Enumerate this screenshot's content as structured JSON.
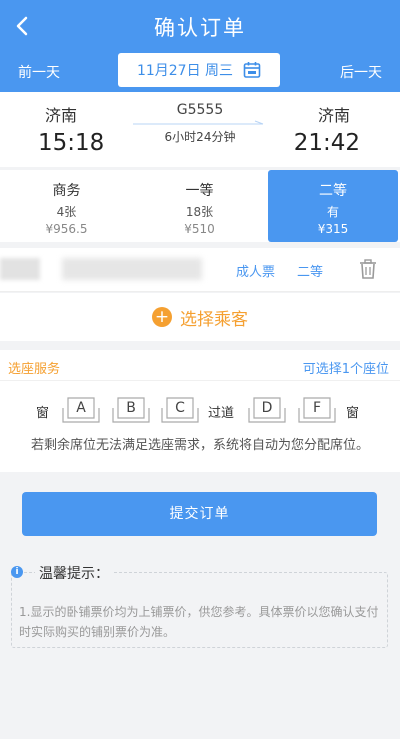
{
  "header": {
    "title": "确认订单",
    "prev_day": "前一天",
    "next_day": "后一天",
    "date": "11月27日 周三",
    "bg_color": "#4a97f0"
  },
  "train": {
    "from_station": "济南",
    "to_station": "济南",
    "departure_time": "15:18",
    "arrival_time": "21:42",
    "train_no": "G5555",
    "duration": "6小时24分钟"
  },
  "seat_classes": [
    {
      "name": "商务",
      "count": "4张",
      "price": "¥956.5",
      "selected": false
    },
    {
      "name": "一等",
      "count": "18张",
      "price": "¥510",
      "selected": false
    },
    {
      "name": "二等",
      "count": "有",
      "price": "¥315",
      "selected": true
    }
  ],
  "passenger": {
    "ticket_type": "成人票",
    "seat_class": "二等"
  },
  "choose_passenger": {
    "label": "选择乘客",
    "icon": "plus-circle-icon"
  },
  "seat_service": {
    "title": "选座服务",
    "hint": "可选择1个座位",
    "window_left": "窗",
    "aisle": "过道",
    "window_right": "窗",
    "seats": [
      "A",
      "B",
      "C",
      "D",
      "F"
    ],
    "note": "若剩余席位无法满足选座需求，系统将自动为您分配席位。"
  },
  "submit": {
    "label": "提交订单"
  },
  "tips": {
    "title": "温馨提示：",
    "text": "1.显示的卧铺票价均为上铺票价，供您参考。具体票价以您确认支付时实际购买的铺别票价为准。"
  },
  "colors": {
    "accent": "#4a97f0",
    "orange": "#f5a031"
  }
}
